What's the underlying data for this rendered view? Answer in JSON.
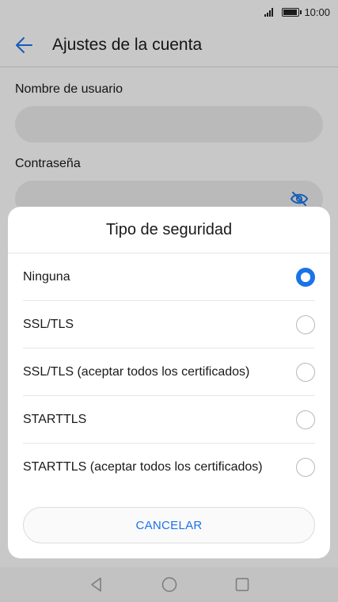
{
  "status_bar": {
    "time": "10:00",
    "battery_level": 0.85
  },
  "app_bar": {
    "title": "Ajustes de la cuenta",
    "back_icon": "arrow-left-icon"
  },
  "form": {
    "username_label": "Nombre de usuario",
    "username_value": "",
    "password_label": "Contraseña",
    "password_value": "",
    "visibility_icon": "eye-off-icon"
  },
  "dialog": {
    "title": "Tipo de seguridad",
    "options": [
      {
        "label": "Ninguna",
        "selected": true
      },
      {
        "label": "SSL/TLS",
        "selected": false
      },
      {
        "label": "SSL/TLS (aceptar todos los certificados)",
        "selected": false
      },
      {
        "label": "STARTTLS",
        "selected": false
      },
      {
        "label": "STARTTLS (aceptar todos los certificados)",
        "selected": false
      }
    ],
    "cancel_label": "CANCELAR"
  },
  "colors": {
    "accent": "#1a73e8",
    "scrim": "rgba(0,0,0,0.2)"
  },
  "nav_bar": {
    "icons": [
      "back-triangle-icon",
      "home-circle-icon",
      "recents-square-icon"
    ]
  }
}
